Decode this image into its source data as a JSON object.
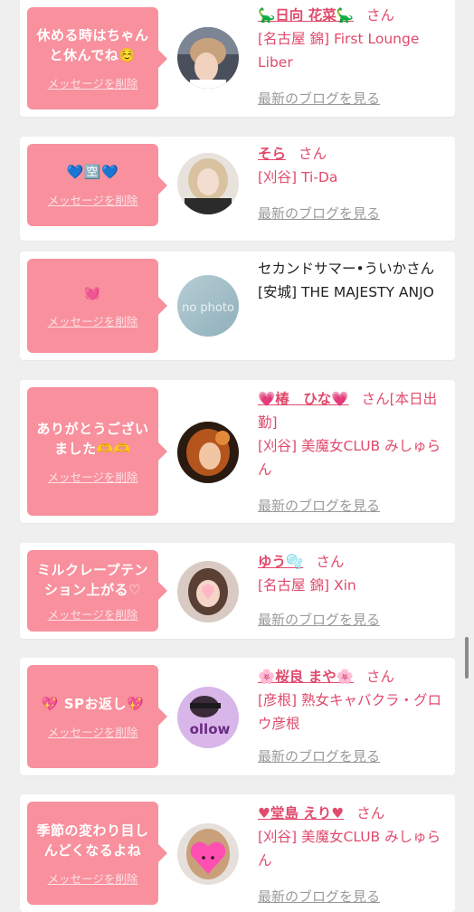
{
  "delete_label": "メッセージを削除",
  "blog_label": "最新のブログを見る",
  "entries": [
    {
      "message": "休める時はちゃんと休んでね☺️",
      "name": "🦕日向 花菜🦕",
      "honorific": "さん",
      "shop": "[名古屋 錦] First Lounge Liber"
    },
    {
      "message": "💙🈳💙",
      "name": "そら",
      "honorific": "さん",
      "shop": "[刈谷] Ti-Da"
    },
    {
      "message": "💓",
      "name": "セカンドサマー•ういかさん",
      "honorific": "",
      "shop": "[安城] THE MAJESTY ANJO",
      "avatar_text": "no photo"
    },
    {
      "message": "ありがとうございました🫶🫶",
      "name": "💗椿　ひな💗",
      "honorific": "さん[本日出勤]",
      "shop": "[刈谷] 美魔女CLUB みしゅらん"
    },
    {
      "message": "ミルクレープテンション上がる♡",
      "name": "ゆう🫧",
      "honorific": "さん",
      "shop": "[名古屋 錦] Xin"
    },
    {
      "message": "💖 SPお返し💖",
      "name": "🌸桜良 まや🌸",
      "honorific": "さん",
      "shop": "[彦根] 熟女キャバクラ・グロウ彦根",
      "avatar_text": "ollow"
    },
    {
      "message": "季節の変わり目しんどくなるよね",
      "name": "♥堂島 えり♥",
      "honorific": "さん",
      "shop": "[刈谷] 美魔女CLUB みしゅらん"
    }
  ]
}
